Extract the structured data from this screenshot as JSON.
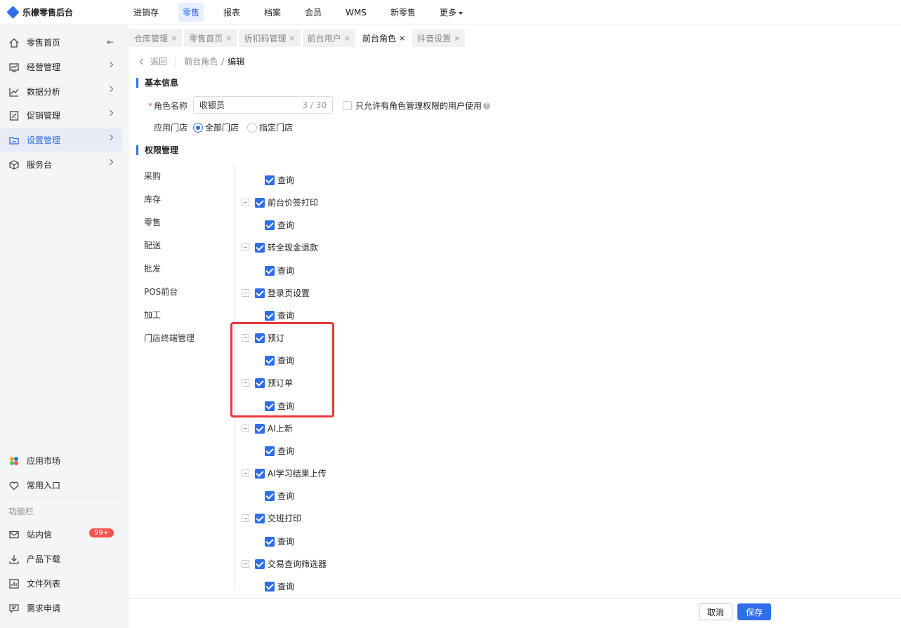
{
  "app": {
    "title": "乐檬零售后台"
  },
  "topnav": {
    "items": [
      "进销存",
      "零售",
      "报表",
      "档案",
      "会员",
      "WMS",
      "新零售",
      "更多"
    ],
    "active": "零售"
  },
  "sidebar": {
    "items": [
      {
        "label": "零售首页",
        "icon": "home-icon"
      },
      {
        "label": "经营管理",
        "icon": "monitor-icon"
      },
      {
        "label": "数据分析",
        "icon": "chart-icon"
      },
      {
        "label": "促销管理",
        "icon": "promo-icon"
      },
      {
        "label": "设置管理",
        "icon": "folder-icon"
      },
      {
        "label": "服务台",
        "icon": "cube-icon"
      }
    ],
    "bottom_items": [
      {
        "label": "应用市场",
        "icon": "app-market-icon"
      },
      {
        "label": "常用入口",
        "icon": "heart-icon"
      }
    ],
    "section_label": "功能栏",
    "func_items": [
      {
        "label": "站内信",
        "icon": "mail-icon",
        "badge": "99+"
      },
      {
        "label": "产品下载",
        "icon": "download-icon"
      },
      {
        "label": "文件列表",
        "icon": "file-list-icon"
      },
      {
        "label": "需求申请",
        "icon": "request-icon"
      }
    ]
  },
  "tabs": [
    {
      "label": "仓库管理"
    },
    {
      "label": "零售首页"
    },
    {
      "label": "折扣码管理"
    },
    {
      "label": "前台用户"
    },
    {
      "label": "前台角色",
      "active": true
    },
    {
      "label": "抖音设置"
    }
  ],
  "tab_close_glyph": "×",
  "breadcrumb": {
    "back": "返回",
    "parent": "前台角色",
    "separator": "/",
    "current": "编辑"
  },
  "basic": {
    "title": "基本信息",
    "role_name_label": "角色名称",
    "required_mark": "*",
    "role_name_value": "收银员",
    "role_name_count": "3 / 30",
    "restrict_label": "只允许有角色管理权限的用户使用",
    "help_glyph": "?",
    "store_label": "应用门店",
    "store_options": [
      "全部门店",
      "指定门店"
    ],
    "store_selected": "全部门店"
  },
  "permissions": {
    "title": "权限管理",
    "categories": [
      "采购",
      "库存",
      "零售",
      "配送",
      "批发",
      "POS前台",
      "加工",
      "门店终端管理"
    ],
    "tree": [
      {
        "label": "查询",
        "level": "child"
      },
      {
        "label": "前台价签打印",
        "level": "parent"
      },
      {
        "label": "查询",
        "level": "child"
      },
      {
        "label": "转全现金退款",
        "level": "parent"
      },
      {
        "label": "查询",
        "level": "child"
      },
      {
        "label": "登录页设置",
        "level": "parent"
      },
      {
        "label": "查询",
        "level": "child"
      },
      {
        "label": "预订",
        "level": "parent"
      },
      {
        "label": "查询",
        "level": "child"
      },
      {
        "label": "预订单",
        "level": "parent"
      },
      {
        "label": "查询",
        "level": "child"
      },
      {
        "label": "AI上新",
        "level": "parent"
      },
      {
        "label": "查询",
        "level": "child"
      },
      {
        "label": "AI学习结果上传",
        "level": "parent"
      },
      {
        "label": "查询",
        "level": "child"
      },
      {
        "label": "交班打印",
        "level": "parent"
      },
      {
        "label": "查询",
        "level": "child"
      },
      {
        "label": "交易查询筛选器",
        "level": "parent"
      },
      {
        "label": "查询",
        "level": "child"
      }
    ]
  },
  "footer": {
    "cancel": "取消",
    "save": "保存"
  },
  "colors": {
    "accent": "#2f6ee9",
    "highlight": "#e8363a",
    "badge": "#f5534f"
  }
}
